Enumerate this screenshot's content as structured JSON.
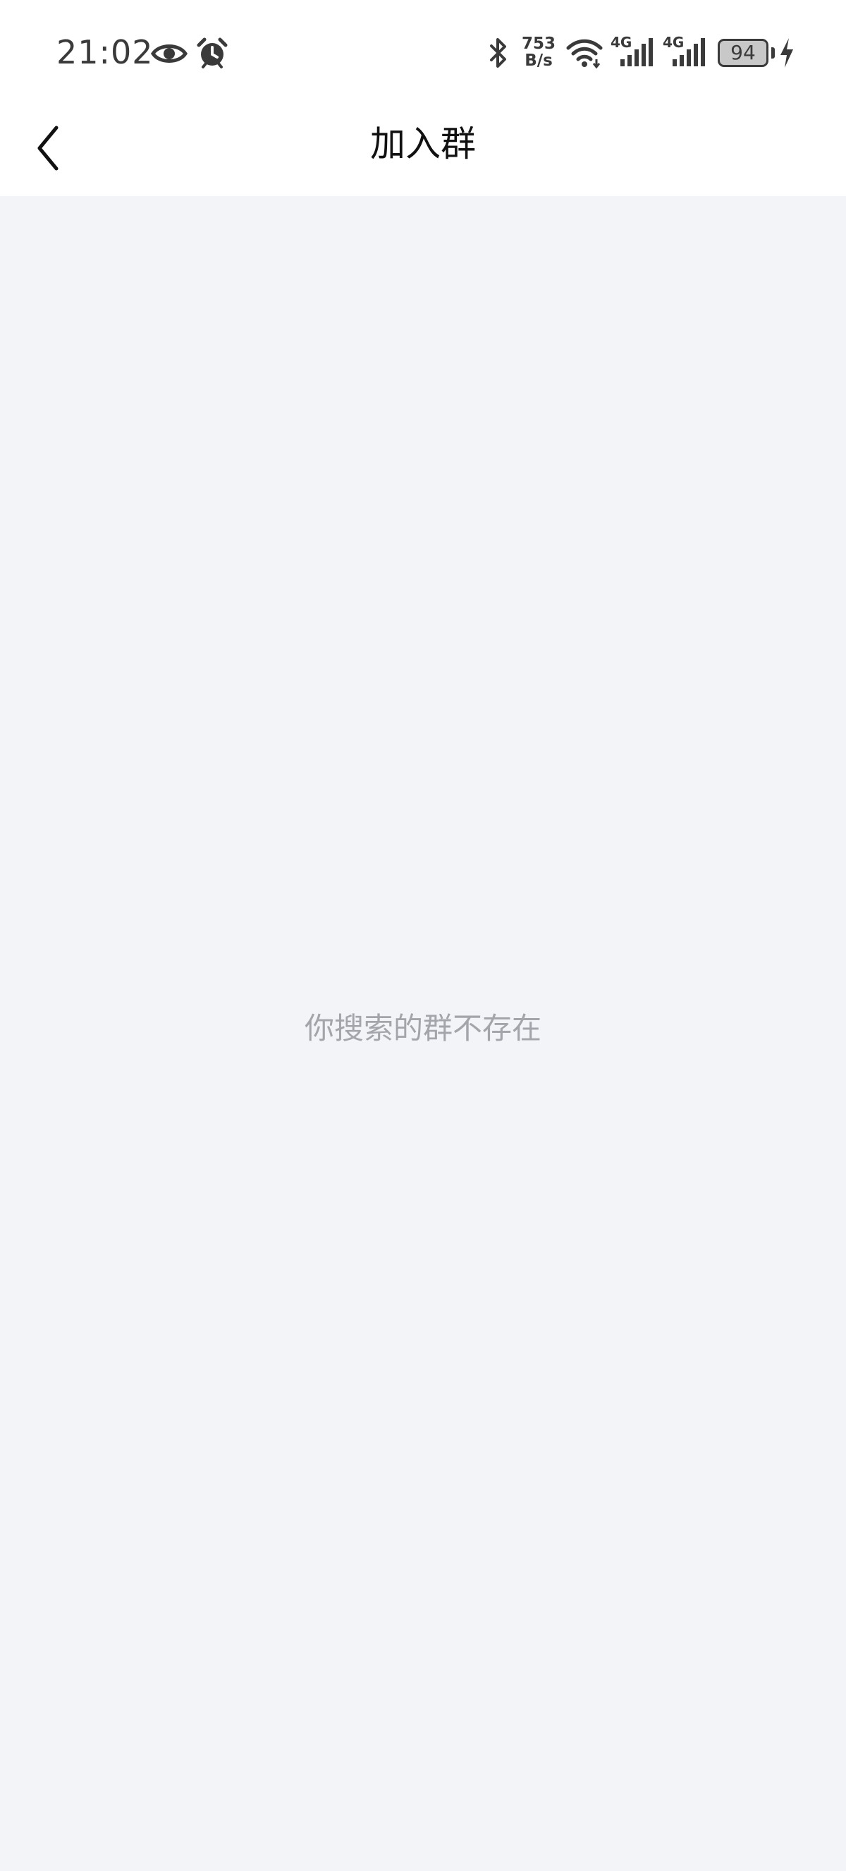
{
  "status_bar": {
    "time": "21:02",
    "network_speed_value": "753",
    "network_speed_unit": "B/s",
    "sim1_network": "4G",
    "sim2_network": "4G",
    "battery_level": "94",
    "icons": [
      "eye-icon",
      "alarm-clock-icon",
      "bluetooth-icon",
      "wifi-icon",
      "signal-icon",
      "battery-icon",
      "charging-bolt-icon"
    ]
  },
  "header": {
    "back_icon": "chevron-left-icon",
    "title": "加入群"
  },
  "main": {
    "empty_message": "你搜索的群不存在"
  },
  "colors": {
    "background": "#f3f4f8",
    "header_background": "#ffffff",
    "title_text": "#111111",
    "empty_text": "#a3a5ab",
    "status_icons": "#3a3a3a"
  }
}
